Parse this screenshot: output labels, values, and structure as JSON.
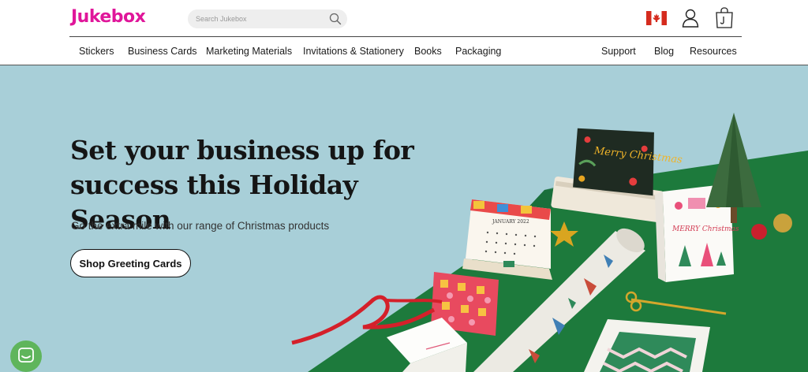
{
  "header": {
    "logo": "Jukebox",
    "search": {
      "placeholder": "Search Jukebox",
      "value": ""
    },
    "icons": [
      "canada-flag-icon",
      "account-icon",
      "shopping-bag-icon"
    ]
  },
  "nav": {
    "left": [
      {
        "label": "Stickers"
      },
      {
        "label": "Business Cards"
      },
      {
        "label": "Marketing Materials"
      },
      {
        "label": "Invitations & Stationery"
      },
      {
        "label": "Books"
      },
      {
        "label": "Packaging"
      }
    ],
    "right": [
      {
        "label": "Support"
      },
      {
        "label": "Blog"
      },
      {
        "label": "Resources"
      }
    ]
  },
  "hero": {
    "headline": "Set your business up for success this Holiday Season",
    "subtext": "Go the extra mile with our range of Christmas products",
    "cta": "Shop Greeting Cards",
    "image_text": {
      "calendar": "JANUARY 2022",
      "card_back": "Merry Christmas",
      "card_front": "MERRY Christmas"
    }
  },
  "colors": {
    "brand": "#e0169a",
    "hero_bg": "#a8cfd8",
    "table_green": "#1d7a3c",
    "chat": "#5fb55c"
  }
}
